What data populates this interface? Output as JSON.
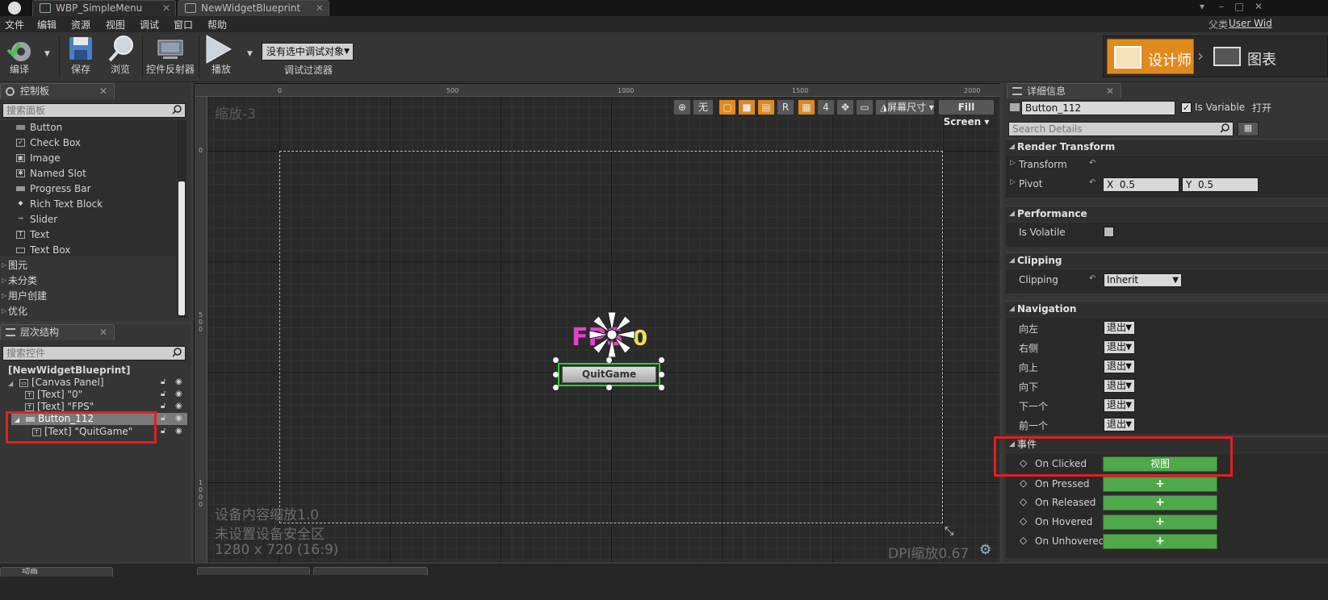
{
  "titlebar": {
    "tabs": [
      "WBP_SimpleMenu",
      "NewWidgetBlueprint"
    ],
    "parent_label": "父类",
    "parent_value": "User Wid"
  },
  "menu": [
    "文件",
    "编辑",
    "资源",
    "视图",
    "调试",
    "窗口",
    "帮助"
  ],
  "toolbar": {
    "compile": "编译",
    "save": "保存",
    "browse": "浏览",
    "reflector": "控件反射器",
    "play": "播放",
    "debug_select": "没有选中调试对象",
    "debug_filter": "调试过滤器",
    "designer_mode": "设计师",
    "graph_mode": "图表"
  },
  "palette": {
    "tab": "控制板",
    "search_placeholder": "搜索面板",
    "items": [
      {
        "label": "Button",
        "icon": "button-icon"
      },
      {
        "label": "Check Box",
        "icon": "checkbox-icon"
      },
      {
        "label": "Image",
        "icon": "image-icon"
      },
      {
        "label": "Named Slot",
        "icon": "named-slot-icon"
      },
      {
        "label": "Progress Bar",
        "icon": "progress-bar-icon"
      },
      {
        "label": "Rich Text Block",
        "icon": "rich-text-icon"
      },
      {
        "label": "Slider",
        "icon": "slider-icon"
      },
      {
        "label": "Text",
        "icon": "text-icon"
      },
      {
        "label": "Text Box",
        "icon": "text-box-icon"
      }
    ],
    "categories": [
      "图元",
      "未分类",
      "用户创建",
      "优化"
    ]
  },
  "hierarchy": {
    "tab": "层次结构",
    "search_placeholder": "搜索控件",
    "root": "[NewWidgetBlueprint]",
    "rows": [
      {
        "label": "[Canvas Panel]"
      },
      {
        "label": "[Text] \"0\""
      },
      {
        "label": "[Text] \"FPS\""
      },
      {
        "label": "Button_112"
      },
      {
        "label": "[Text] \"QuitGame\""
      }
    ]
  },
  "designer": {
    "zoom": "缩放-3",
    "ruler_top": [
      "0",
      "500",
      "1000",
      "1500",
      "2000"
    ],
    "ruler_left": [
      "0",
      "5\n0\n0",
      "1\n0\n0\n0"
    ],
    "toolbar": {
      "none_label": "无",
      "r_label": "R",
      "grid_size": "4",
      "screen_size": "屏幕尺寸",
      "fill_screen": "Fill Screen"
    },
    "fps_text": "FPS",
    "zero_text": "0",
    "button_text": "QuitGame",
    "info_scale": "设备内容缩放1.0",
    "info_safe": "未设置设备安全区",
    "info_res": "1280 x 720 (16:9)",
    "dpi": "DPI缩放0.67"
  },
  "details": {
    "tab": "详细信息",
    "name_value": "Button_112",
    "is_variable": "Is Variable",
    "open_btn": "打开",
    "search_placeholder": "Search Details",
    "sections": {
      "render_transform": "Render Transform",
      "performance": "Performance",
      "clipping": "Clipping",
      "navigation": "Navigation",
      "events": "事件"
    },
    "transform": "Transform",
    "pivot": "Pivot",
    "pivot_x_label": "X",
    "pivot_x": "0.5",
    "pivot_y_label": "Y",
    "pivot_y": "0.5",
    "is_volatile": "Is Volatile",
    "clipping_label": "Clipping",
    "clipping_value": "Inherit",
    "nav": [
      {
        "label": "向左",
        "value": "退出"
      },
      {
        "label": "右侧",
        "value": "退出"
      },
      {
        "label": "向上",
        "value": "退出"
      },
      {
        "label": "向下",
        "value": "退出"
      },
      {
        "label": "下一个",
        "value": "退出"
      },
      {
        "label": "前一个",
        "value": "退出"
      }
    ],
    "events": [
      {
        "label": "On Clicked",
        "button": "视图"
      },
      {
        "label": "On Pressed",
        "button": "+"
      },
      {
        "label": "On Released",
        "button": "+"
      },
      {
        "label": "On Hovered",
        "button": "+"
      },
      {
        "label": "On Unhovered",
        "button": "+"
      }
    ]
  },
  "bottom": {
    "anim_tab": "动画"
  },
  "colors": {
    "accent_orange": "#e08a1e",
    "event_green": "#4fa84a",
    "highlight_red": "#e02020",
    "selection_green": "#2bd12b",
    "fps_pink": "#e83fd0",
    "zero_yellow": "#f2e04a"
  }
}
